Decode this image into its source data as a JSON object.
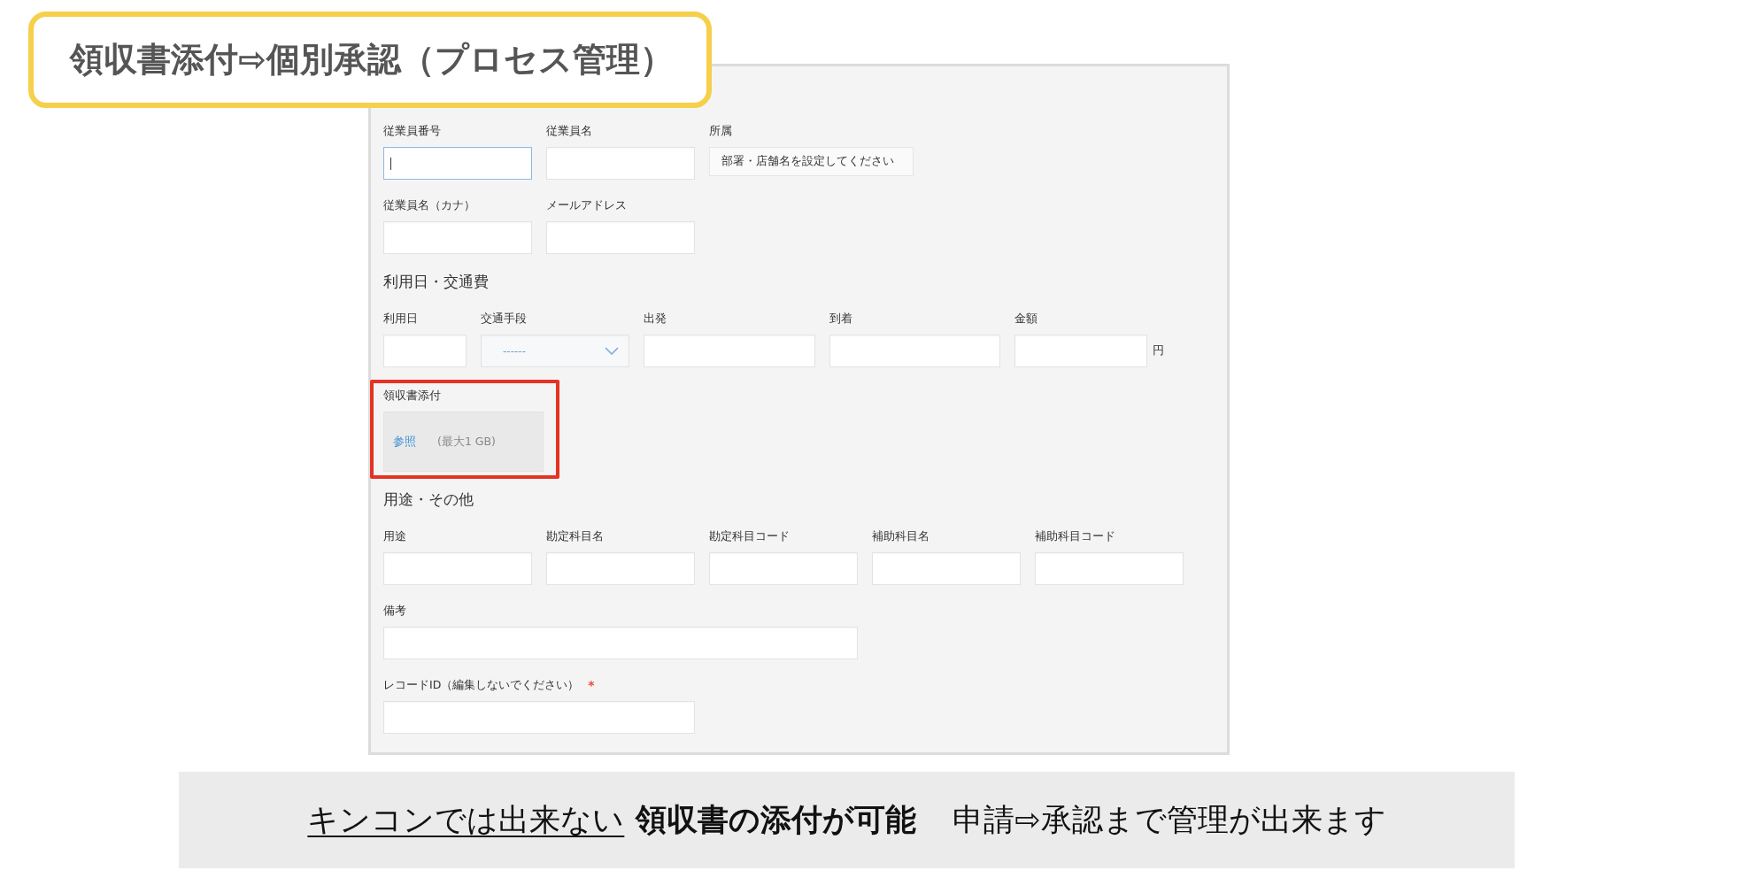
{
  "title_badge": {
    "text": "領収書添付⇨個別承認（プロセス管理）"
  },
  "form": {
    "rows": [
      {
        "kind": "fields",
        "fields": [
          {
            "label": "従業員番号",
            "kind": "text",
            "focused": true,
            "highlighted": false
          },
          {
            "label": "従業員名",
            "kind": "text",
            "focused": false,
            "highlighted": false
          },
          {
            "label": "所属",
            "kind": "display",
            "value": "部署・店舗名を設定してください",
            "focused": false,
            "highlighted": false
          }
        ]
      },
      {
        "kind": "fields",
        "fields": [
          {
            "label": "従業員名（カナ）",
            "kind": "text",
            "focused": false,
            "highlighted": false
          },
          {
            "label": "メールアドレス",
            "kind": "text",
            "focused": false,
            "highlighted": false
          }
        ]
      },
      {
        "kind": "heading",
        "text": "利用日・交通費"
      },
      {
        "kind": "fields",
        "fields": [
          {
            "label": "利用日",
            "kind": "text",
            "focused": false,
            "highlighted": false
          },
          {
            "label": "交通手段",
            "kind": "select",
            "value": "------",
            "focused": false,
            "highlighted": false
          },
          {
            "label": "出発",
            "kind": "text",
            "focused": false,
            "highlighted": false
          },
          {
            "label": "到着",
            "kind": "text",
            "focused": false,
            "highlighted": false
          },
          {
            "label": "金額",
            "kind": "text",
            "unit": "円",
            "focused": false,
            "highlighted": false
          }
        ]
      },
      {
        "kind": "fields",
        "fields": [
          {
            "label": "領収書添付",
            "kind": "file",
            "button": "参照",
            "note": "(最大1 GB)",
            "focused": false,
            "highlighted": true
          }
        ]
      },
      {
        "kind": "heading",
        "text": "用途・その他"
      },
      {
        "kind": "fields",
        "fields": [
          {
            "label": "用途",
            "kind": "text",
            "focused": false,
            "highlighted": false
          },
          {
            "label": "勘定科目名",
            "kind": "text",
            "focused": false,
            "highlighted": false
          },
          {
            "label": "勘定科目コード",
            "kind": "text",
            "focused": false,
            "highlighted": false
          },
          {
            "label": "補助科目名",
            "kind": "text",
            "focused": false,
            "highlighted": false
          },
          {
            "label": "補助科目コード",
            "kind": "text",
            "focused": false,
            "highlighted": false
          }
        ]
      },
      {
        "kind": "fields",
        "fields": [
          {
            "label": "備考",
            "kind": "text",
            "focused": false,
            "highlighted": false
          }
        ]
      },
      {
        "kind": "fields",
        "fields": [
          {
            "label": "レコードID（編集しないでください）",
            "required_mark": "*",
            "kind": "text",
            "focused": false,
            "highlighted": false
          }
        ]
      }
    ]
  },
  "banner": {
    "segments": [
      {
        "text": "キンコンでは出来ない",
        "kind": "underlined"
      },
      {
        "text": "領収書の添付が可能",
        "kind": "bold"
      },
      {
        "text": "申請⇨承認まで管理が出来ます",
        "kind": "plain"
      }
    ]
  }
}
